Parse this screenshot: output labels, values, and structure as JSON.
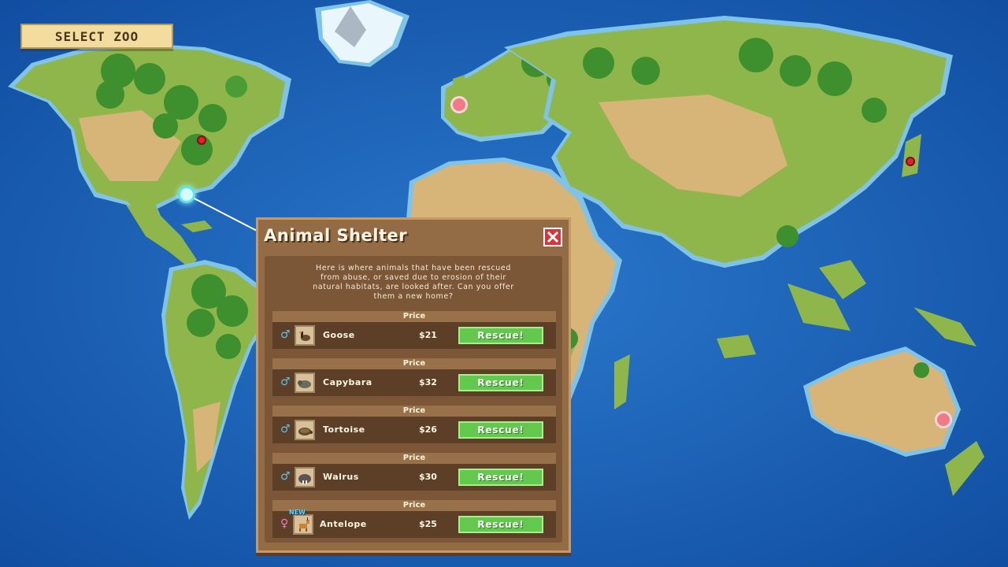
{
  "header": {
    "select_zoo_label": "SELECT ZOO"
  },
  "dialog": {
    "title": "Animal Shelter",
    "close_icon": "close-icon",
    "description": "Here is where animals that have been rescued\nfrom abuse, or saved due to erosion of their\nnatural habitats, are looked after. Can you offer\nthem a new home?",
    "price_header": "Price",
    "button_label": "Rescue!",
    "animals": [
      {
        "gender": "♂",
        "gender_name": "male",
        "name": "Goose",
        "price": "$21",
        "icon": "goose-icon",
        "is_new": false
      },
      {
        "gender": "♂",
        "gender_name": "male",
        "name": "Capybara",
        "price": "$32",
        "icon": "capybara-icon",
        "is_new": false
      },
      {
        "gender": "♂",
        "gender_name": "male",
        "name": "Tortoise",
        "price": "$26",
        "icon": "tortoise-icon",
        "is_new": false
      },
      {
        "gender": "♂",
        "gender_name": "male",
        "name": "Walrus",
        "price": "$30",
        "icon": "walrus-icon",
        "is_new": false
      },
      {
        "gender": "♀",
        "gender_name": "female",
        "name": "Antelope",
        "price": "$25",
        "icon": "antelope-icon",
        "is_new": true,
        "badge": "NEW"
      }
    ]
  },
  "colors": {
    "ocean": "#1a5fb8",
    "land": "#8fb64a",
    "desert": "#d7b478",
    "forest": "#3e8f2e",
    "dialog_bg": "#936b45",
    "rescue_green": "#63c94e",
    "close_red": "#d8343a"
  }
}
